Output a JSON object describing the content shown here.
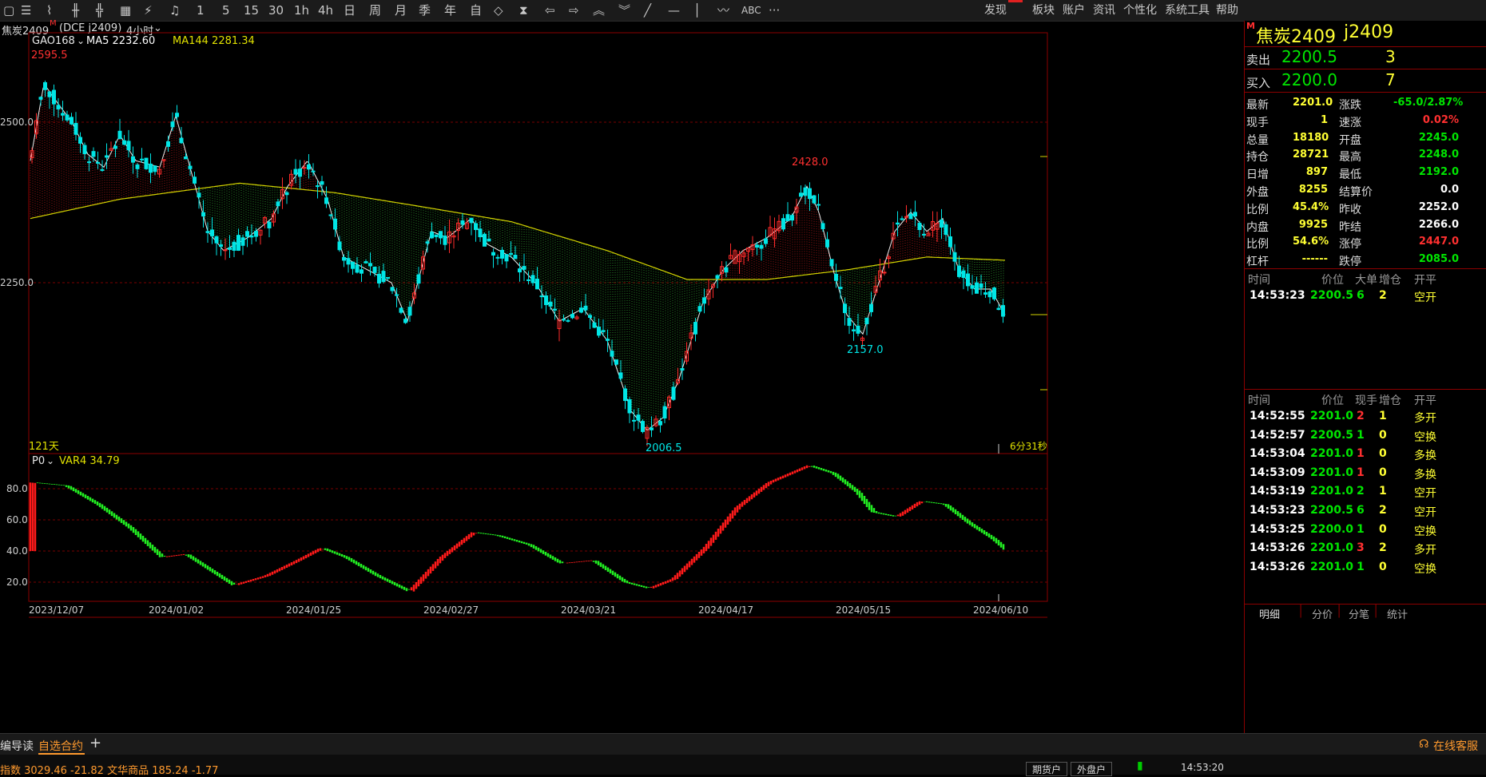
{
  "toolbar": {
    "icons": [
      "grid-icon",
      "list-icon",
      "draw-icon",
      "kline-icon",
      "pan-icon",
      "table-icon",
      "signal-icon",
      "bell-icon"
    ],
    "periods": [
      "1",
      "5",
      "15",
      "30",
      "1h",
      "4h",
      "日",
      "周",
      "月",
      "季",
      "年",
      "自"
    ],
    "tools": [
      "diamond-icon",
      "hourglass-icon",
      "left-arrow-icon",
      "right-arrow-icon",
      "double-up-icon",
      "double-down-icon",
      "line-icon",
      "hline-icon",
      "vline-icon",
      "wave-icon"
    ],
    "abc": "ABC",
    "more": "···",
    "menu": [
      "发现",
      "板块",
      "账户",
      "资讯",
      "个性化",
      "系统工具",
      "帮助"
    ]
  },
  "infobar": {
    "symbol": "焦炭2409",
    "exchange": "(DCE  j2409)",
    "period": "4小时"
  },
  "main_chart": {
    "indicator": "GAO168",
    "ma5_label": "MA5 2232.60",
    "ma144_label": "MA144 2281.34",
    "y_ticks": [
      "2500.0",
      "2250.0"
    ],
    "high_label": "2595.5",
    "peak_label": "2428.0",
    "trough_label": "2157.0",
    "low_label": "2006.5",
    "days_label": "121天",
    "countdown": "6分31秒"
  },
  "sub_chart": {
    "indicator": "P0",
    "var_label": "VAR4 34.79",
    "y_ticks": [
      "80.0",
      "60.0",
      "40.0",
      "20.0"
    ]
  },
  "x_dates": [
    "2023/12/07",
    "2024/01/02",
    "2024/01/25",
    "2024/02/27",
    "2024/03/21",
    "2024/04/17",
    "2024/05/15",
    "2024/06/10"
  ],
  "quote": {
    "name": "焦炭2409",
    "code": "j2409",
    "badge": "M",
    "ask_label": "卖出",
    "ask_price": "2200.5",
    "ask_vol": "3",
    "bid_label": "买入",
    "bid_price": "2200.0",
    "bid_vol": "7",
    "stats": [
      [
        "最新",
        "2201.0",
        "涨跌",
        "-65.0/2.87%"
      ],
      [
        "现手",
        "1",
        "速涨",
        "0.02%"
      ],
      [
        "总量",
        "18180",
        "开盘",
        "2245.0"
      ],
      [
        "持仓",
        "28721",
        "最高",
        "2248.0"
      ],
      [
        "日增",
        "897",
        "最低",
        "2192.0"
      ],
      [
        "外盘",
        "8255",
        "结算价",
        "0.0"
      ],
      [
        "比例",
        "45.4%",
        "昨收",
        "2252.0"
      ],
      [
        "内盘",
        "9925",
        "昨结",
        "2266.0"
      ],
      [
        "比例",
        "54.6%",
        "涨停",
        "2447.0"
      ],
      [
        "杠杆",
        "------",
        "跌停",
        "2085.0"
      ]
    ],
    "big_header": [
      "时间",
      "价位",
      "大单",
      "增仓",
      "开平"
    ],
    "big_rows": [
      [
        "14:53:23",
        "2200.5",
        "6",
        "2",
        "空开"
      ]
    ],
    "tick_header": [
      "时间",
      "价位",
      "现手",
      "增仓",
      "开平"
    ],
    "ticks": [
      [
        "14:52:55",
        "2201.0",
        "2",
        "1",
        "多开"
      ],
      [
        "14:52:57",
        "2200.5",
        "1",
        "0",
        "空换"
      ],
      [
        "14:53:04",
        "2201.0",
        "1",
        "0",
        "多换"
      ],
      [
        "14:53:09",
        "2201.0",
        "1",
        "0",
        "多换"
      ],
      [
        "14:53:19",
        "2201.0",
        "2",
        "1",
        "空开"
      ],
      [
        "14:53:23",
        "2200.5",
        "6",
        "2",
        "空开"
      ],
      [
        "14:53:25",
        "2200.0",
        "1",
        "0",
        "空换"
      ],
      [
        "14:53:26",
        "2201.0",
        "3",
        "2",
        "多开"
      ],
      [
        "14:53:26",
        "2201.0",
        "1",
        "0",
        "空换"
      ]
    ],
    "tabs": [
      "明细",
      "分价",
      "分笔",
      "统计"
    ]
  },
  "bottom": {
    "tabs": [
      "编导读",
      "自选合约"
    ],
    "add": "+",
    "service": "在线客服",
    "ticker": "指数  3029.46  -21.82    文华商品  185.24  -1.77",
    "btn1": "期货户",
    "btn2": "外盘户",
    "time": "14:53:20"
  },
  "colors": {
    "up": "#ff2b2b",
    "down": "#00e5e5",
    "ma144": "#d4d400",
    "osc_up": "#ff1a1a",
    "osc_down": "#22ee22"
  }
}
